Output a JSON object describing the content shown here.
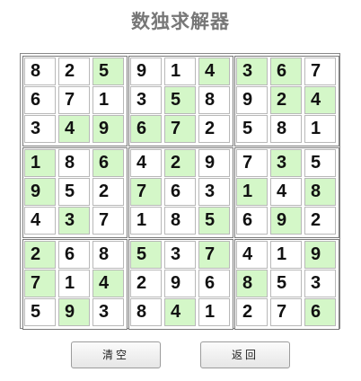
{
  "title": "数独求解器",
  "highlight_color": "#d4f7c8",
  "grid": [
    [
      "8",
      "2",
      "5",
      "9",
      "1",
      "4",
      "3",
      "6",
      "7"
    ],
    [
      "6",
      "7",
      "1",
      "3",
      "5",
      "8",
      "9",
      "2",
      "4"
    ],
    [
      "3",
      "4",
      "9",
      "6",
      "7",
      "2",
      "5",
      "8",
      "1"
    ],
    [
      "1",
      "8",
      "6",
      "4",
      "2",
      "9",
      "7",
      "3",
      "5"
    ],
    [
      "9",
      "5",
      "2",
      "7",
      "6",
      "3",
      "1",
      "4",
      "8"
    ],
    [
      "4",
      "3",
      "7",
      "1",
      "8",
      "5",
      "6",
      "9",
      "2"
    ],
    [
      "2",
      "6",
      "8",
      "5",
      "3",
      "7",
      "4",
      "1",
      "9"
    ],
    [
      "7",
      "1",
      "4",
      "2",
      "9",
      "6",
      "8",
      "5",
      "3"
    ],
    [
      "5",
      "9",
      "3",
      "8",
      "4",
      "1",
      "2",
      "7",
      "6"
    ]
  ],
  "highlighted": [
    [
      false,
      false,
      true,
      false,
      false,
      true,
      true,
      true,
      false
    ],
    [
      false,
      false,
      false,
      false,
      true,
      false,
      false,
      true,
      true
    ],
    [
      false,
      true,
      true,
      true,
      true,
      false,
      false,
      false,
      false
    ],
    [
      true,
      false,
      true,
      false,
      true,
      false,
      false,
      true,
      false
    ],
    [
      true,
      false,
      false,
      true,
      false,
      false,
      true,
      false,
      true
    ],
    [
      false,
      true,
      false,
      false,
      false,
      true,
      false,
      true,
      false
    ],
    [
      true,
      false,
      false,
      true,
      false,
      true,
      false,
      false,
      true
    ],
    [
      true,
      false,
      true,
      false,
      false,
      false,
      true,
      false,
      false
    ],
    [
      false,
      true,
      false,
      false,
      true,
      false,
      false,
      false,
      true
    ]
  ],
  "buttons": {
    "clear_label": "清空",
    "back_label": "返回"
  }
}
